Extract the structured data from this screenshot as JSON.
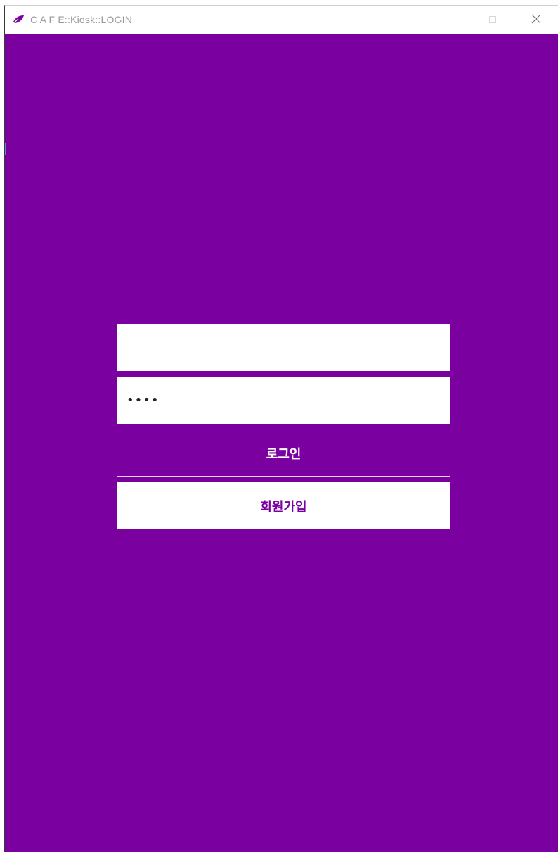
{
  "window": {
    "title": "C A F E::Kiosk::LOGIN",
    "app_icon": "cafe-leaf-icon",
    "controls": {
      "minimize_icon": "minimize-icon",
      "maximize_icon": "maximize-icon",
      "close_icon": "close-icon"
    }
  },
  "login_form": {
    "id_field": {
      "value": "",
      "placeholder": ""
    },
    "password_field": {
      "value": "1234",
      "placeholder": ""
    },
    "login_button_label": "로그인",
    "register_button_label": "회원가입"
  },
  "colors": {
    "background": "#7b00a0",
    "field_background": "#ffffff",
    "login_button_text": "#ffffff",
    "register_button_text": "#7b00a0"
  }
}
